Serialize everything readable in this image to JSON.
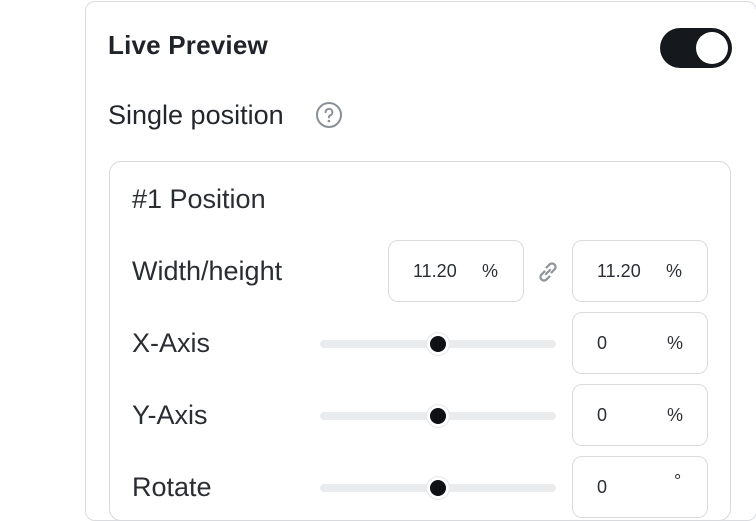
{
  "live_preview": {
    "title": "Live Preview",
    "enabled": true
  },
  "single_position": {
    "label": "Single position",
    "help_icon": "question-circle-icon"
  },
  "position_card": {
    "title": "#1 Position",
    "width_height": {
      "label": "Width/height",
      "width_value": "11.20",
      "width_unit": "%",
      "height_value": "11.20",
      "height_unit": "%",
      "link_icon": "link-icon"
    },
    "x_axis": {
      "label": "X-Axis",
      "value": "0",
      "unit": "%",
      "slider_fraction": 0.5
    },
    "y_axis": {
      "label": "Y-Axis",
      "value": "0",
      "unit": "%",
      "slider_fraction": 0.5
    },
    "rotate": {
      "label": "Rotate",
      "value": "0",
      "unit": "°",
      "slider_fraction": 0.5
    }
  },
  "colors": {
    "toggle_on": "#15191e",
    "slider_thumb": "#0f1114",
    "slider_track": "#eaebed",
    "border": "#d9dbde"
  }
}
